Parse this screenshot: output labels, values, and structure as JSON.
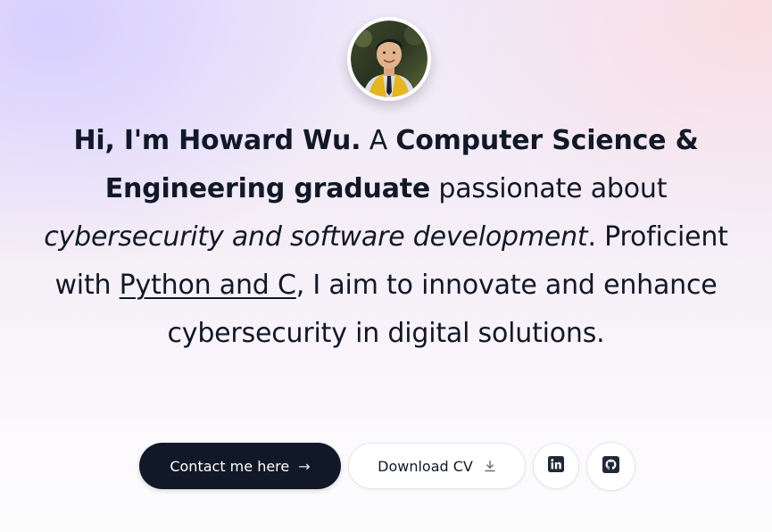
{
  "profile": {
    "avatar_alt": "Howard Wu profile photo"
  },
  "intro": {
    "greeting": "Hi, I'm Howard Wu.",
    "text_a": " A ",
    "degree": "Computer Science & Engineering graduate",
    "text_b": " passionate about ",
    "interests": "cybersecurity and software development",
    "text_c": ". Proficient with ",
    "skills": "Python and C",
    "text_d": ", I aim to innovate and enhance cybersecurity in digital solutions."
  },
  "actions": {
    "contact_label": "Contact me here",
    "contact_icon": "arrow-right-icon",
    "download_label": "Download CV",
    "download_icon": "download-icon",
    "linkedin_icon": "linkedin-icon",
    "github_icon": "github-icon"
  },
  "colors": {
    "primary": "#111827",
    "text": "#111827",
    "muted": "#6b7280",
    "white": "#ffffff"
  }
}
